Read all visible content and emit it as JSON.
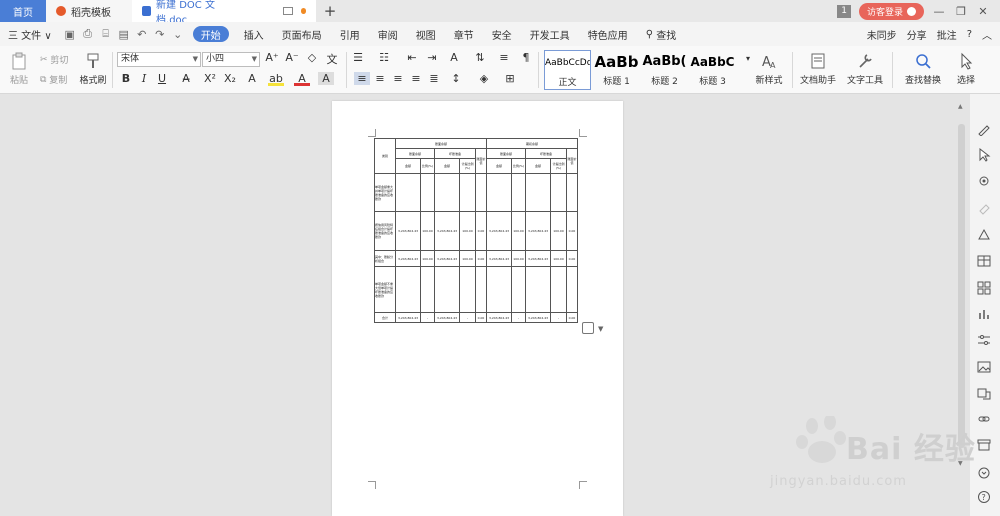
{
  "titlebar": {
    "tabs": [
      {
        "label": "首页"
      },
      {
        "label": "稻壳模板"
      },
      {
        "label": "新建 DOC 文档.doc"
      }
    ],
    "new_tab": "+",
    "counter": "1",
    "login": "访客登录",
    "window_controls": [
      "—",
      "❐",
      "✕"
    ]
  },
  "menubar": {
    "file": "三 文件 ∨",
    "items": [
      "开始",
      "插入",
      "页面布局",
      "引用",
      "审阅",
      "视图",
      "章节",
      "安全",
      "开发工具",
      "特色应用",
      "查找"
    ],
    "active": "开始",
    "right": [
      "未同步",
      "分享",
      "批注",
      "?",
      "︿"
    ]
  },
  "ribbon": {
    "paste": "粘贴",
    "cut": "剪切",
    "copy": "复制",
    "format_painter": "格式刷",
    "font_name": "宋体",
    "font_size": "小四",
    "styles": [
      {
        "preview": "AaBbCcDd",
        "name": "正文"
      },
      {
        "preview": "AaBb",
        "name": "标题 1"
      },
      {
        "preview": "AaBb(",
        "name": "标题 2"
      },
      {
        "preview": "AaBbC",
        "name": "标题 3"
      }
    ],
    "new_style": "新样式",
    "doc_assistant": "文档助手",
    "text_tools": "文字工具",
    "find_replace": "查找替换",
    "select": "选择"
  },
  "doc_table": {
    "group_headers": [
      "账面余额",
      "期初余额"
    ],
    "sub_headers": [
      "账面余额",
      "坏账准备"
    ],
    "category": "类别",
    "book_value": "账面价值",
    "amount": "金额",
    "ratio": "比例(%)",
    "provision_ratio": "计提比例(%)",
    "rows": [
      {
        "label": "单项金额重大并单项计提坏账准备的应收账款",
        "cells": [
          "",
          "",
          "",
          "",
          "",
          "",
          "",
          "",
          "",
          ""
        ]
      },
      {
        "label": "按信用风险特征组合计提坏账准备的应收账款",
        "cells": [
          "3,243,804.43",
          "100.00",
          "3,243,804.43",
          "100.00",
          "0.00",
          "3,243,804.43",
          "100.00",
          "3,243,804.43",
          "100.00",
          "0.00"
        ]
      },
      {
        "label": "其中：账龄分析组合",
        "cells": [
          "3,243,804.43",
          "100.00",
          "3,243,804.43",
          "100.00",
          "0.00",
          "3,243,804.43",
          "100.00",
          "3,243,804.43",
          "100.00",
          "0.00"
        ]
      },
      {
        "label": "单项金额不重大但单项计提坏账准备的应收账款",
        "cells": [
          "",
          "",
          "",
          "",
          "",
          "",
          "",
          "",
          "",
          ""
        ]
      },
      {
        "label": "合计",
        "cells": [
          "3,243,804.43",
          "-",
          "3,243,804.43",
          "-",
          "0.00",
          "3,243,804.43",
          "-",
          "3,243,804.43",
          "-",
          "0.00"
        ]
      }
    ]
  },
  "watermark": {
    "brand": "Bai 经验",
    "url": "jingyan.baidu.com"
  }
}
